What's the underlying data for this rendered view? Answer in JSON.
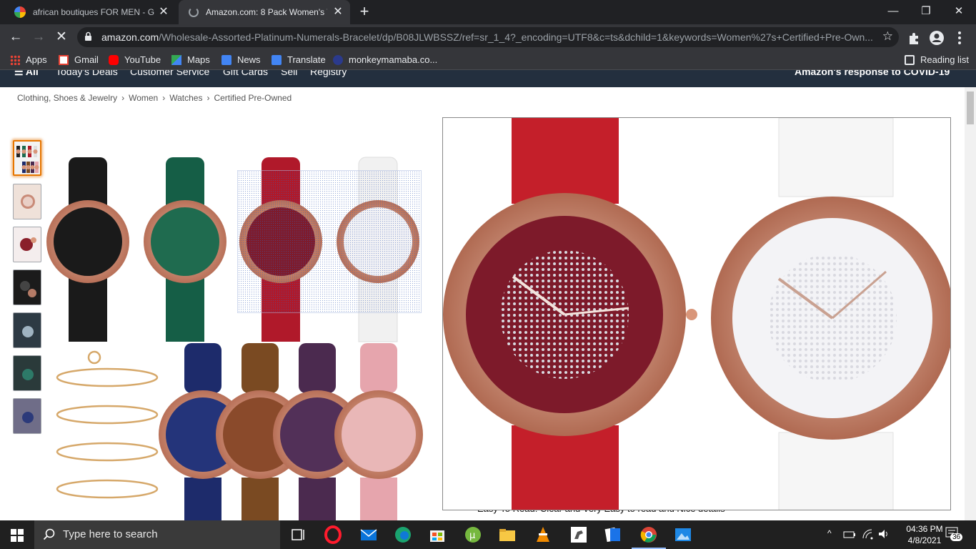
{
  "tabs": [
    {
      "title": "african boutiques FOR MEN - Go",
      "active": false
    },
    {
      "title": "Amazon.com: 8 Pack Women's W",
      "active": true
    }
  ],
  "toolbar": {
    "url_host": "amazon.com",
    "url_path": "/Wholesale-Assorted-Platinum-Numerals-Bracelet/dp/B08JLWBSSZ/ref=sr_1_4?_encoding=UTF8&c=ts&dchild=1&keywords=Women%27s+Certified+Pre-Own..."
  },
  "bookmarks": {
    "items": [
      {
        "label": "Apps",
        "icon": "apps-grid-icon"
      },
      {
        "label": "Gmail",
        "icon": "gmail-icon"
      },
      {
        "label": "YouTube",
        "icon": "youtube-icon"
      },
      {
        "label": "Maps",
        "icon": "maps-icon"
      },
      {
        "label": "News",
        "icon": "news-icon"
      },
      {
        "label": "Translate",
        "icon": "translate-icon"
      },
      {
        "label": "monkeymamaba.co...",
        "icon": "site-icon"
      }
    ],
    "reading_list": "Reading list"
  },
  "amazon_nav": {
    "items": [
      "All",
      "Today's Deals",
      "Customer Service",
      "Gift Cards",
      "Sell",
      "Registry"
    ],
    "covid": "Amazon's response to COVID-19"
  },
  "breadcrumb": [
    "Clothing, Shoes & Jewelry",
    "Women",
    "Watches",
    "Certified Pre-Owned"
  ],
  "product": {
    "description_peek": "Easy To Read: Clear and Very Easy to read and Nice details"
  },
  "taskbar": {
    "search_placeholder": "Type here to search",
    "time": "04:36 PM",
    "date": "4/8/2021",
    "notifications": "36"
  },
  "colors": {
    "amazon_nav": "#232f3e",
    "thumb_selected": "#e77600",
    "rose_gold": "#d9967a"
  }
}
